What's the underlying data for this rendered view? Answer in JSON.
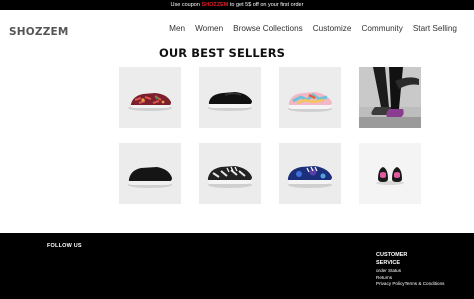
{
  "promo": {
    "before": "Use coupon ",
    "code": "SHOZZEM",
    "after": " to get 5$ off on your first order"
  },
  "brand": {
    "name": "SHOZZEM"
  },
  "nav": {
    "items": [
      "Men",
      "Women",
      "Browse Collections",
      "Customize",
      "Community",
      "Start Selling"
    ]
  },
  "section": {
    "title": "OUR BEST SELLERS"
  },
  "products": [
    {
      "image": "red-floral-slip-on-shoe"
    },
    {
      "image": "black-slip-on-shoe"
    },
    {
      "image": "pastel-print-slip-on-shoe"
    },
    {
      "image": "person-wearing-sneakers-photo"
    },
    {
      "image": "black-low-top-shoe"
    },
    {
      "image": "black-white-pattern-lace-up-shoe"
    },
    {
      "image": "blue-galaxy-lace-up-shoe"
    },
    {
      "image": "pink-black-lace-up-shoes-pair"
    }
  ],
  "footer": {
    "follow_us": "FOLLOW US",
    "customer_service": {
      "title": "CUSTOMER SERVICE",
      "links": [
        "order Status",
        "Returns"
      ],
      "privacy": "Privacy Policy",
      "terms": "Terms & Conditions"
    }
  },
  "colors": {
    "promo_code": "#e11d2a",
    "footer_bg": "#000000",
    "tile_bg": "#ececec"
  }
}
